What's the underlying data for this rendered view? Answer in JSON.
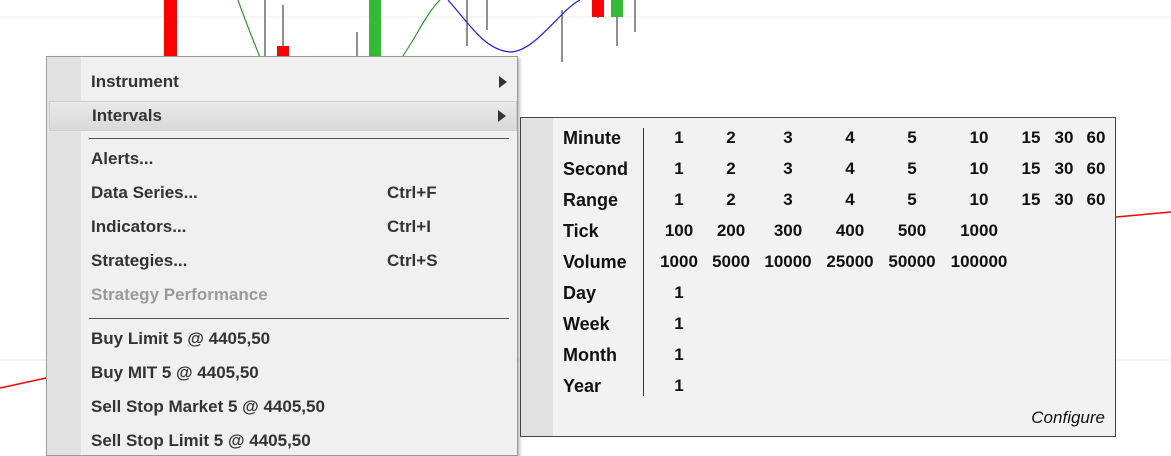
{
  "context_menu": {
    "items": [
      {
        "label": "Instrument",
        "submenu": true
      },
      {
        "label": "Intervals",
        "submenu": true,
        "highlighted": true
      },
      {
        "label": "Alerts..."
      },
      {
        "label": "Data Series...",
        "shortcut": "Ctrl+F"
      },
      {
        "label": "Indicators...",
        "shortcut": "Ctrl+I"
      },
      {
        "label": "Strategies...",
        "shortcut": "Ctrl+S"
      },
      {
        "label": "Strategy Performance",
        "disabled": true
      },
      {
        "label": "Buy Limit 5 @ 4405,50"
      },
      {
        "label": "Buy MIT 5 @ 4405,50"
      },
      {
        "label": "Sell Stop Market 5 @ 4405,50"
      },
      {
        "label": "Sell Stop Limit 5 @ 4405,50"
      }
    ]
  },
  "intervals_submenu": {
    "rows": [
      {
        "label": "Minute",
        "values": [
          "1",
          "2",
          "3",
          "4",
          "5",
          "10",
          "15",
          "30",
          "60"
        ]
      },
      {
        "label": "Second",
        "values": [
          "1",
          "2",
          "3",
          "4",
          "5",
          "10",
          "15",
          "30",
          "60"
        ]
      },
      {
        "label": "Range",
        "values": [
          "1",
          "2",
          "3",
          "4",
          "5",
          "10",
          "15",
          "30",
          "60"
        ]
      },
      {
        "label": "Tick",
        "values": [
          "100",
          "200",
          "300",
          "400",
          "500",
          "1000"
        ]
      },
      {
        "label": "Volume",
        "values": [
          "1000",
          "5000",
          "10000",
          "25000",
          "50000",
          "100000"
        ]
      },
      {
        "label": "Day",
        "values": [
          "1"
        ]
      },
      {
        "label": "Week",
        "values": [
          "1"
        ]
      },
      {
        "label": "Month",
        "values": [
          "1"
        ]
      },
      {
        "label": "Year",
        "values": [
          "1"
        ]
      }
    ],
    "configure_label": "Configure"
  },
  "colors": {
    "bull_candle": "#33bb33",
    "bear_candle": "#ff0000",
    "blue_line": "#1a1aff",
    "green_line": "#2a9a2a",
    "red_line": "#ff0000"
  }
}
